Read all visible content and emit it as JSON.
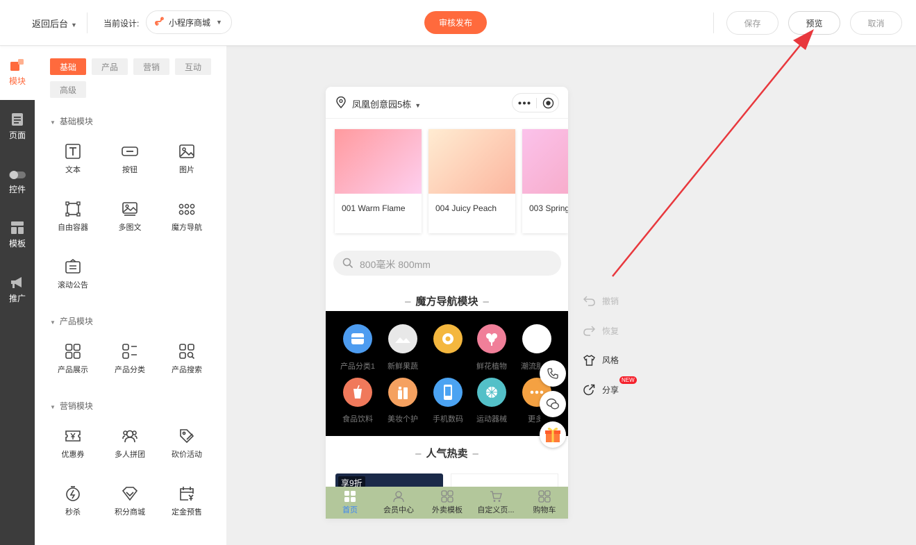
{
  "topbar": {
    "back_label": "返回后台",
    "current_design_label": "当前设计:",
    "design_name": "小程序商城",
    "publish_label": "审核发布",
    "save_label": "保存",
    "preview_label": "预览",
    "cancel_label": "取消"
  },
  "leftnav": [
    {
      "label": "模块",
      "icon": "blocks-icon"
    },
    {
      "label": "页面",
      "icon": "page-icon"
    },
    {
      "label": "控件",
      "icon": "toggle-icon"
    },
    {
      "label": "模板",
      "icon": "template-icon"
    },
    {
      "label": "推广",
      "icon": "megaphone-icon"
    }
  ],
  "panel": {
    "tabs": [
      "基础",
      "产品",
      "营销",
      "互动",
      "高级"
    ],
    "sections": [
      {
        "title": "基础模块",
        "items": [
          "文本",
          "按钮",
          "图片",
          "自由容器",
          "多图文",
          "魔方导航",
          "滚动公告"
        ]
      },
      {
        "title": "产品模块",
        "items": [
          "产品展示",
          "产品分类",
          "产品搜索"
        ]
      },
      {
        "title": "营销模块",
        "items": [
          "优惠券",
          "多人拼团",
          "砍价活动",
          "秒杀",
          "积分商城",
          "定金预售"
        ]
      }
    ]
  },
  "phone": {
    "location": "凤凰创意园5栋",
    "cards": [
      {
        "label": "001 Warm Flame"
      },
      {
        "label": "004 Juicy Peach"
      },
      {
        "label": "003 Spring"
      }
    ],
    "search_placeholder": "800毫米 800mm",
    "nav_title": "魔方导航模块",
    "nav_items": [
      "产品分类1",
      "新鲜果蔬",
      "",
      "鲜花植物",
      "潮流服",
      "食品饮料",
      "美妆个护",
      "手机数码",
      "运动器械",
      "更多"
    ],
    "hot_title": "人气热卖",
    "hot_badge": "享9折",
    "tabs": [
      "首页",
      "会员中心",
      "外卖模板",
      "自定义页...",
      "购物车"
    ]
  },
  "tools": {
    "undo": "撤销",
    "redo": "恢复",
    "style": "风格",
    "share": "分享",
    "new_badge": "NEW"
  },
  "colors": {
    "accent": "#ff6a3d",
    "nav_dark": "#3c3c3c",
    "tabbar": "#b3c79b",
    "active_tab": "#3d86f5",
    "annotation_arrow": "#e8383d"
  }
}
